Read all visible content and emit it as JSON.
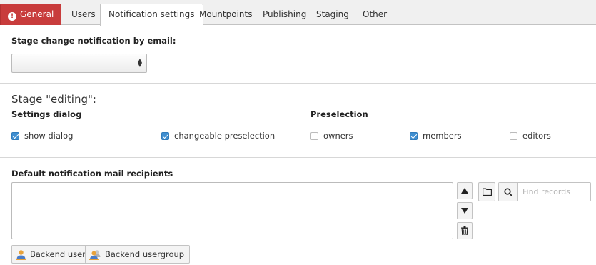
{
  "tabs": [
    {
      "label": "General",
      "error": true
    },
    {
      "label": "Users"
    },
    {
      "label": "Notification settings",
      "active": true
    },
    {
      "label": "Mountpoints"
    },
    {
      "label": "Publishing"
    },
    {
      "label": "Staging"
    },
    {
      "label": "Other"
    }
  ],
  "notification": {
    "label": "Stage change notification by email:",
    "select_value": ""
  },
  "stage": {
    "title": "Stage \"editing\":",
    "settings_heading": "Settings dialog",
    "preselection_heading": "Preselection",
    "checkboxes": [
      {
        "label": "show dialog",
        "checked": true
      },
      {
        "label": "changeable preselection",
        "checked": true
      },
      {
        "label": "owners",
        "checked": false
      },
      {
        "label": "members",
        "checked": true
      },
      {
        "label": "editors",
        "checked": false
      }
    ]
  },
  "recipients": {
    "label": "Default notification mail recipients",
    "find_placeholder": "Find records",
    "backend_user_label": "Backend user",
    "backend_usergroup_label": "Backend usergroup"
  },
  "colors": {
    "error_tab": "#c83c3c",
    "checkbox_on": "#3e8ed0",
    "user_icon": "#e8a23a"
  }
}
